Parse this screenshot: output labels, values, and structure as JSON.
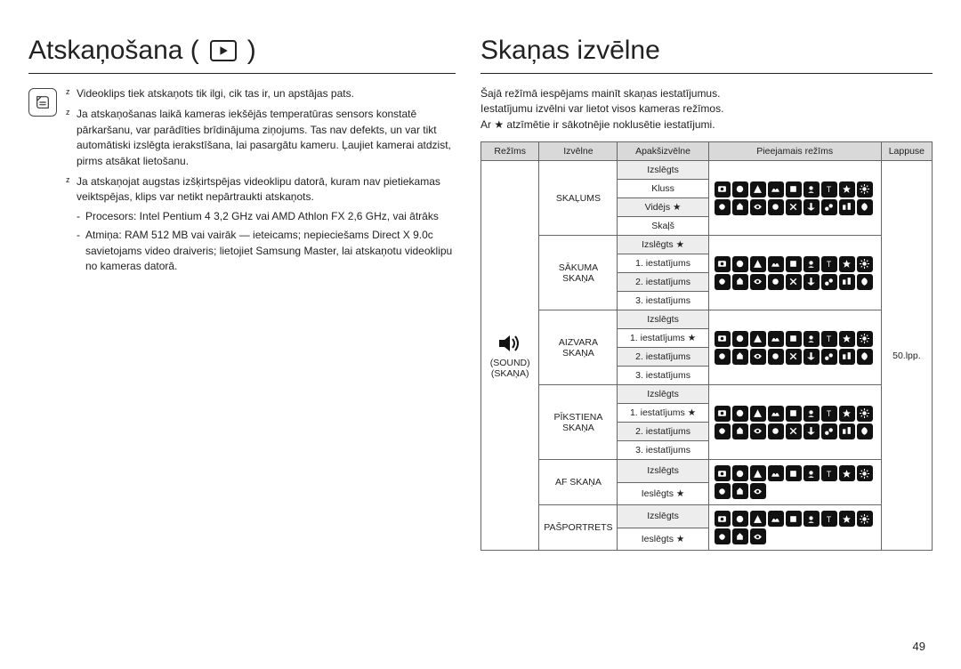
{
  "left": {
    "title": "Atskaņošana (",
    "title_close": ")",
    "notes": [
      "Videoklips tiek atskaņots tik ilgi, cik tas ir, un apstājas pats.",
      "Ja atskaņošanas laikā kameras iekšējās temperatūras sensors konstatē pārkaršanu, var parādīties brīdinājuma ziņojums. Tas nav defekts, un var tikt automātiski izslēgta ierakstīšana, lai pasargātu kameru. Ļaujiet kamerai atdzist, pirms atsākat lietošanu.",
      "Ja atskaņojat augstas izšķirtspējas videoklipu datorā, kuram nav pietiekamas veiktspējas, klips var netikt nepārtraukti atskaņots."
    ],
    "subnotes": [
      "Procesors: Intel Pentium 4 3,2 GHz vai AMD Athlon FX 2,6 GHz, vai ātrāks",
      "Atmiņa: RAM 512 MB vai vairāk — ieteicams; nepieciešams Direct X 9.0c savietojams video draiveris; lietojiet Samsung Master, lai atskaņotu videoklipu no kameras datorā."
    ]
  },
  "right": {
    "title": "Skaņas izvēlne",
    "intro_line1": "Šajā režīmā iespējams mainīt skaņas iestatījumus.",
    "intro_line2": "Iestatījumu izvēlni var lietot visos kameras režīmos.",
    "intro_star": "Ar  ★  atzīmētie ir sākotnējie noklusētie iestatījumi.",
    "table": {
      "headers": [
        "Režīms",
        "Izvēlne",
        "Apakšizvēlne",
        "Pieejamais režīms",
        "Lappuse"
      ],
      "mode_label_1": "(SOUND)",
      "mode_label_2": "(SKAŅA)",
      "page_ref": "50.lpp.",
      "groups": [
        {
          "menu": "SKAĻUMS",
          "subs": [
            "Izslēgts",
            "Kluss",
            "Vidējs ★",
            "Skaļš"
          ]
        },
        {
          "menu": "SĀKUMA SKAŅA",
          "subs": [
            "Izslēgts ★",
            "1. iestatījums",
            "2. iestatījums",
            "3. iestatījums"
          ]
        },
        {
          "menu": "AIZVARA SKAŅA",
          "subs": [
            "Izslēgts",
            "1. iestatījums ★",
            "2. iestatījums",
            "3. iestatījums"
          ]
        },
        {
          "menu": "PĪKSTIENA SKAŅA",
          "subs": [
            "Izslēgts",
            "1. iestatījums ★",
            "2. iestatījums",
            "3. iestatījums"
          ]
        },
        {
          "menu": "AF SKAŅA",
          "subs": [
            "Izslēgts",
            "Ieslēgts ★"
          ]
        },
        {
          "menu": "PAŠPORTRETS",
          "subs": [
            "Izslēgts",
            "Ieslēgts ★"
          ]
        }
      ]
    }
  },
  "page_number": "49"
}
